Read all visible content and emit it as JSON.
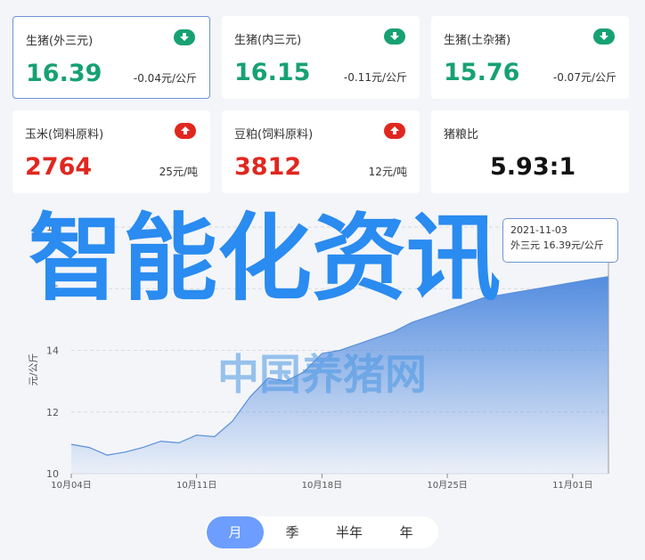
{
  "cards": [
    {
      "name": "生猪(外三元)",
      "value": "16.39",
      "change": "-0.04元/公斤",
      "trend": "down"
    },
    {
      "name": "生猪(内三元)",
      "value": "16.15",
      "change": "-0.11元/公斤",
      "trend": "down"
    },
    {
      "name": "生猪(土杂猪)",
      "value": "15.76",
      "change": "-0.07元/公斤",
      "trend": "down"
    },
    {
      "name": "玉米(饲料原料)",
      "value": "2764",
      "change": "25元/吨",
      "trend": "up"
    },
    {
      "name": "豆粕(饲料原料)",
      "value": "3812",
      "change": "12元/吨",
      "trend": "up"
    },
    {
      "name": "猪粮比",
      "value": "5.93:1"
    }
  ],
  "colors": {
    "down": "#17a173",
    "up": "#e0271f",
    "accent": "#6c9dff",
    "line": "#3f7fd6"
  },
  "overlay": {
    "title": "智能化资讯",
    "subtitle": "中国养猪网"
  },
  "tooltip": {
    "date": "2021-11-03",
    "line": "外三元 16.39元/公斤"
  },
  "period_tabs": [
    "月",
    "季",
    "半年",
    "年"
  ],
  "chart_data": {
    "type": "area",
    "ylabel": "元/公斤",
    "ylim": [
      10,
      18
    ],
    "yticks": [
      10,
      12,
      14,
      16,
      18
    ],
    "xticks": [
      "10月04日",
      "10月11日",
      "10月18日",
      "10月25日",
      "11月01日"
    ],
    "x": [
      "10-04",
      "10-05",
      "10-06",
      "10-07",
      "10-08",
      "10-09",
      "10-10",
      "10-11",
      "10-12",
      "10-13",
      "10-14",
      "10-15",
      "10-16",
      "10-17",
      "10-18",
      "10-19",
      "10-20",
      "10-21",
      "10-22",
      "10-23",
      "10-24",
      "10-25",
      "10-26",
      "10-27",
      "10-28",
      "10-29",
      "10-30",
      "10-31",
      "11-01",
      "11-02",
      "11-03"
    ],
    "series": [
      {
        "name": "外三元",
        "values": [
          10.95,
          10.85,
          10.6,
          10.7,
          10.85,
          11.05,
          11.0,
          11.25,
          11.2,
          11.7,
          12.5,
          13.1,
          13.0,
          13.3,
          13.9,
          14.0,
          14.2,
          14.4,
          14.6,
          14.9,
          15.1,
          15.3,
          15.5,
          15.7,
          15.8,
          15.9,
          16.0,
          16.1,
          16.2,
          16.3,
          16.39
        ]
      }
    ]
  }
}
